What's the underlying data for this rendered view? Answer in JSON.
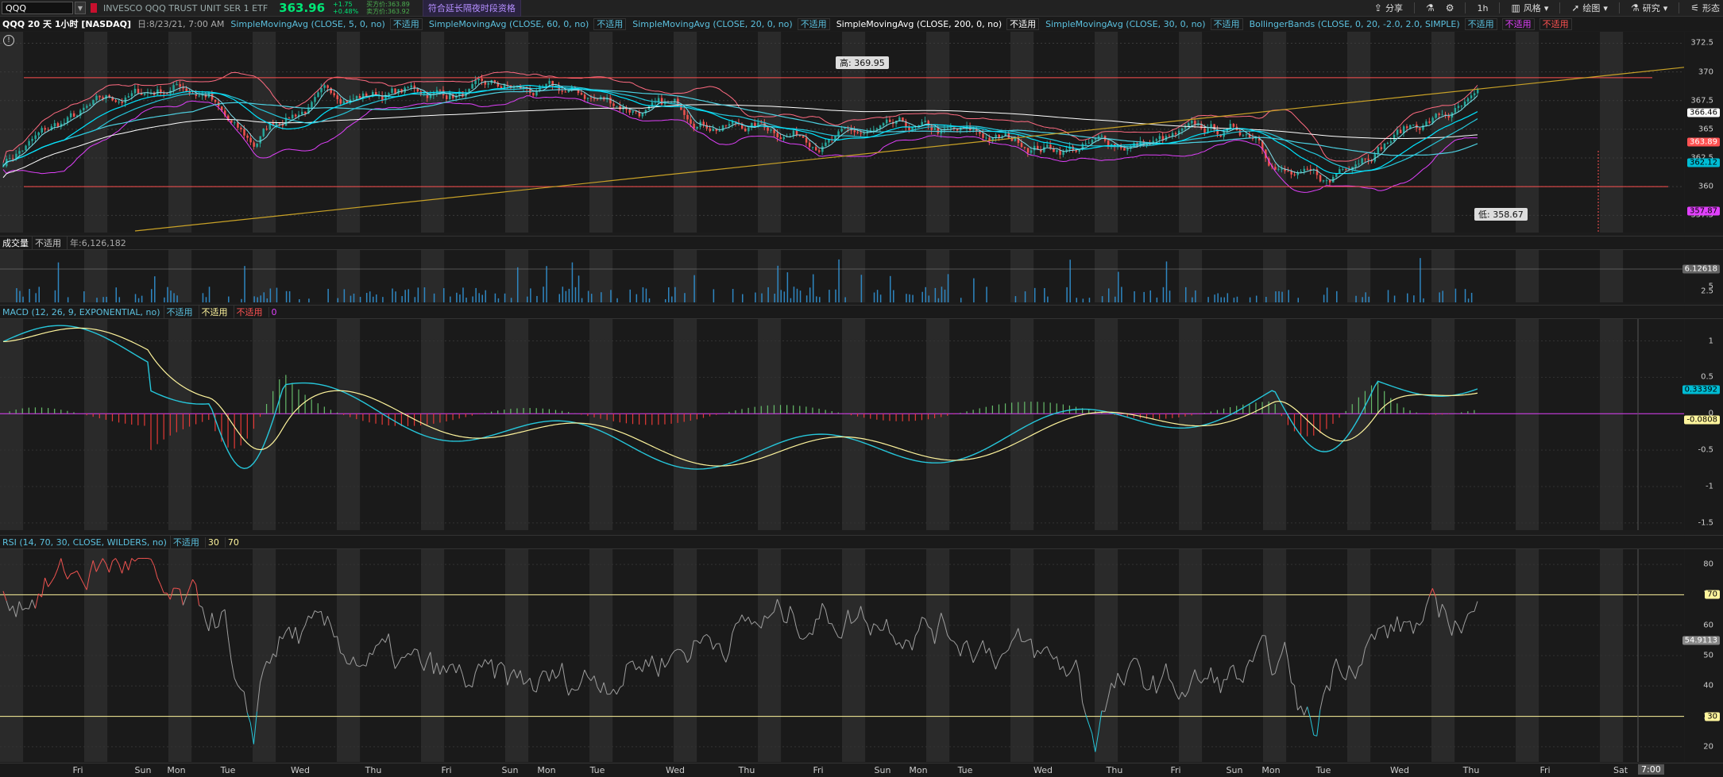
{
  "header": {
    "symbol": "QQQ",
    "instrument_name": "INVESCO QQQ TRUST UNIT SER 1 ETF",
    "last_price": "363.96",
    "change": "+1.75",
    "change_pct": "+0.48%",
    "bid": "买方价:363.89",
    "ask": "卖方价:363.92",
    "ext_hours_badge": "符合延长隔夜时段资格",
    "toolbar": [
      {
        "label": "分享",
        "icon": "share-icon"
      },
      {
        "label": "",
        "icon": "flask-icon"
      },
      {
        "label": "",
        "icon": "settings-icon"
      },
      {
        "label": "1h",
        "icon": "timeframe-icon"
      },
      {
        "label": "风格",
        "icon": "style-icon"
      },
      {
        "label": "绘图",
        "icon": "drawing-cursor-icon"
      },
      {
        "label": "研究",
        "icon": "studies-icon"
      },
      {
        "label": "形态",
        "icon": "patterns-icon"
      }
    ]
  },
  "studies_bar": {
    "title": "QQQ 20 天 1小时 [NASDAQ]",
    "date": "日:8/23/21, 7:00 AM",
    "items": [
      {
        "label": "SimpleMovingAvg (CLOSE, 5, 0, no)",
        "color": "#5bc0de",
        "na": "不适用"
      },
      {
        "label": "SimpleMovingAvg (CLOSE, 60, 0, no)",
        "color": "#5bc0de",
        "na": "不适用"
      },
      {
        "label": "SimpleMovingAvg (CLOSE, 20, 0, no)",
        "color": "#5bc0de",
        "na": "不适用"
      },
      {
        "label": "SimpleMovingAvg (CLOSE, 200, 0, no)",
        "color": "#ffffff",
        "na": "不适用"
      },
      {
        "label": "SimpleMovingAvg (CLOSE, 30, 0, no)",
        "color": "#5bc0de",
        "na": "不适用"
      },
      {
        "label": "BollingerBands (CLOSE, 0, 20, -2.0, 2.0, SIMPLE)",
        "color": "#5bc0de",
        "na": "不适用"
      }
    ],
    "extra_na": [
      {
        "label": "不适用",
        "color": "#e040fb"
      },
      {
        "label": "不适用",
        "color": "#ff5252"
      }
    ]
  },
  "price_pane": {
    "axis_ticks": [
      "372.5",
      "370",
      "367.5",
      "365",
      "362.5",
      "360",
      "357.5"
    ],
    "badges": [
      {
        "value": "366.46",
        "bg": "#ffffff",
        "fg": "#000000",
        "price": 366.46
      },
      {
        "value": "363.89",
        "bg": "#ff5252",
        "fg": "#ffffff",
        "price": 363.89
      },
      {
        "value": "362.12",
        "bg": "#00bcd4",
        "fg": "#000000",
        "price": 362.12
      },
      {
        "value": "357.87",
        "bg": "#e040fb",
        "fg": "#000000",
        "price": 357.87
      }
    ],
    "high_label": "高: 369.95",
    "low_label": "低: 358.67",
    "resistance": 369.5,
    "support": 360.0
  },
  "volume_pane": {
    "title": "成交量",
    "na": "不适用",
    "value": "年:6,126,182",
    "axis_ticks": [
      "5",
      "2.5"
    ],
    "badge": "6.12618"
  },
  "macd_pane": {
    "title": "MACD (12, 26, 9, EXPONENTIAL, no)",
    "na": [
      "不适用",
      "不适用",
      "不适用"
    ],
    "zero": "0",
    "axis_ticks": [
      "1",
      "0.5",
      "0",
      "-0.5",
      "-1",
      "-1.5"
    ],
    "badges": [
      {
        "value": "0.33392",
        "bg": "#00bcd4",
        "fg": "#000000",
        "v": 0.33392
      },
      {
        "value": "-0.0808",
        "bg": "#fff59d",
        "fg": "#000000",
        "v": -0.0808
      }
    ]
  },
  "rsi_pane": {
    "title": "RSI (14, 70, 30, CLOSE, WILDERS, no)",
    "na": "不适用",
    "levels": [
      "30",
      "70"
    ],
    "axis_ticks": [
      "80",
      "70",
      "60",
      "50",
      "40",
      "30",
      "20"
    ],
    "badges": [
      {
        "value": "70",
        "bg": "#fff59d",
        "fg": "#000000",
        "v": 70
      },
      {
        "value": "54.9113",
        "bg": "#888888",
        "fg": "#ffffff",
        "v": 54.9113
      },
      {
        "value": "30",
        "bg": "#fff59d",
        "fg": "#000000",
        "v": 30
      }
    ]
  },
  "time_axis": {
    "ticks": [
      "Fri",
      "Sun",
      "Mon",
      "Tue",
      "Wed",
      "Thu",
      "Fri",
      "Sun",
      "Mon",
      "Tue",
      "Wed",
      "Thu",
      "Fri",
      "Sun",
      "Mon",
      "Tue",
      "Wed",
      "Thu",
      "Fri",
      "Sun",
      "Mon",
      "Tue",
      "Wed",
      "Thu",
      "Fri",
      "Sat"
    ],
    "cursor_time": "7:00"
  }
}
